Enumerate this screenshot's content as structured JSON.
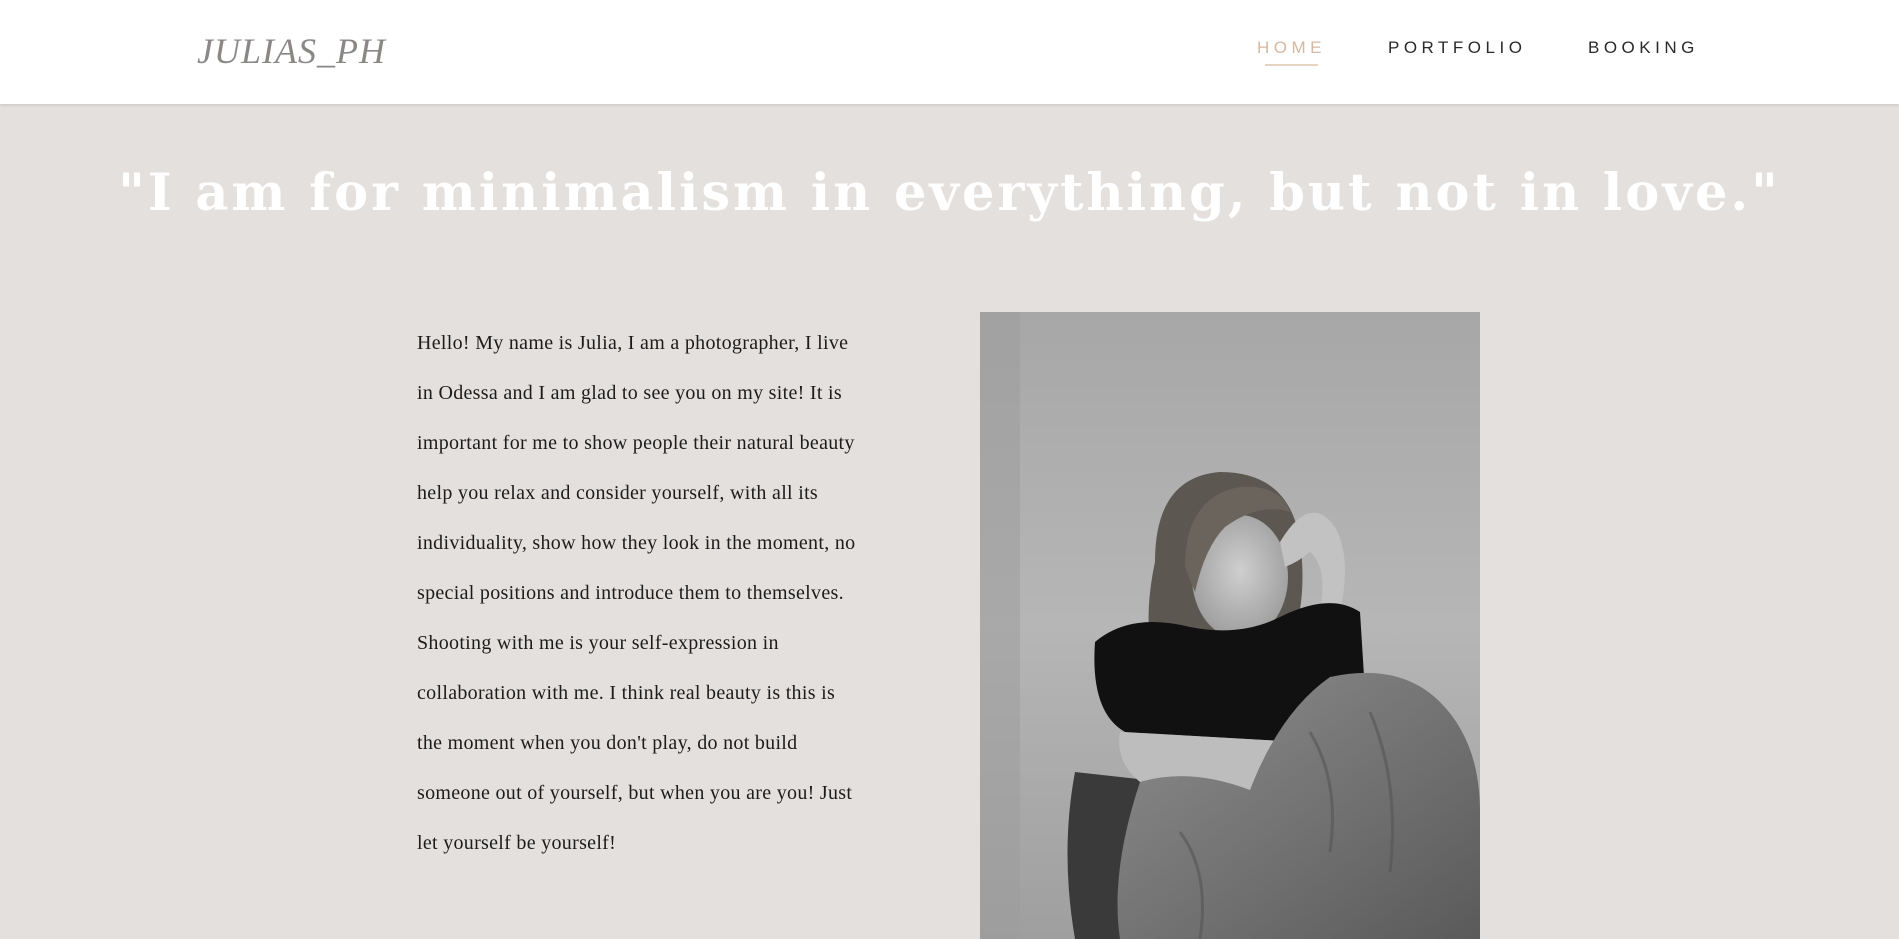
{
  "header": {
    "logo": "JULIAS_PH",
    "nav": [
      {
        "label": "HOME",
        "active": true
      },
      {
        "label": "PORTFOLIO",
        "active": false
      },
      {
        "label": "BOOKING",
        "active": false
      }
    ]
  },
  "hero": {
    "quote": "\"I am for minimalism in everything, but not in love.\""
  },
  "about": {
    "text": "Hello! My name is Julia, I am a photographer, I live in Odessa and I am glad to see you on my site! It is important for me to show people their natural beauty help you relax and consider yourself, with all its individuality, show how they look in the moment, no special positions and introduce them to themselves. Shooting with me is your self-expression in collaboration with me. I think real beauty is this is the moment when you don't play, do not build someone out of yourself, but when you are you! Just let yourself be yourself!"
  },
  "colors": {
    "background": "#e3e0de",
    "header_bg": "#ffffff",
    "accent": "#d6b8a0",
    "quote_text": "#ffffff",
    "body_text": "#1c1c1c"
  }
}
